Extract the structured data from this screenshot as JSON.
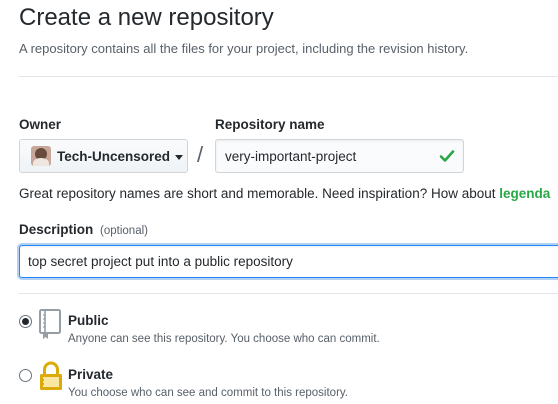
{
  "header": {
    "title": "Create a new repository",
    "subtitle": "A repository contains all the files for your project, including the revision history."
  },
  "owner": {
    "label": "Owner",
    "value": "Tech-Uncensored",
    "icons": {
      "avatar": "user-avatar",
      "dropdown": "caret-down-icon"
    }
  },
  "separator": "/",
  "repository": {
    "label": "Repository name",
    "value": "very-important-project",
    "valid_icon": "check-icon",
    "valid_color": "#28a745"
  },
  "hint": {
    "text": "Great repository names are short and memorable. Need inspiration? How about",
    "suggestion": "legenda"
  },
  "description": {
    "label": "Description",
    "optional_label": "(optional)",
    "value": "top secret project put into a public repository"
  },
  "visibility": {
    "selected": "public",
    "options": [
      {
        "id": "public",
        "label": "Public",
        "description": "Anyone can see this repository. You choose who can commit.",
        "icon": "repo-book-icon"
      },
      {
        "id": "private",
        "label": "Private",
        "description": "You choose who can see and commit to this repository.",
        "icon": "lock-icon"
      }
    ]
  },
  "colors": {
    "focus_border": "#2188ff",
    "text": "#24292e",
    "muted": "#586069",
    "accent_green": "#28a745"
  }
}
